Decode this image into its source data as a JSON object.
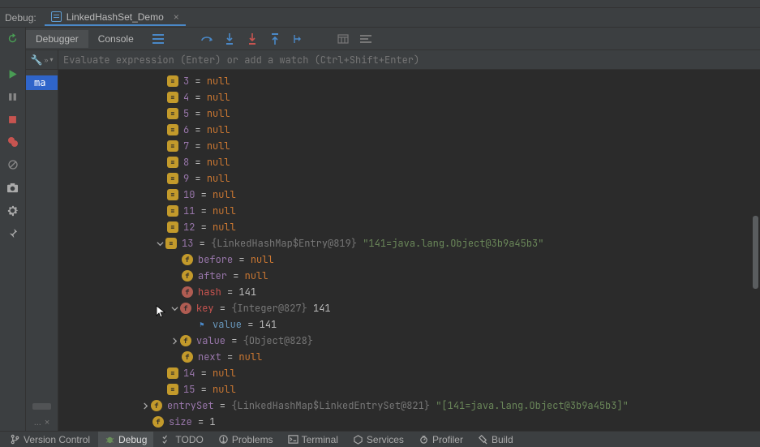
{
  "debug_label": "Debug:",
  "run_config": "LinkedHashSet_Demo",
  "tabs": {
    "debugger": "Debugger",
    "console": "Console"
  },
  "eval_placeholder": "Evaluate expression (Enter) or add a watch (Ctrl+Shift+Enter)",
  "frame_selected": "ma",
  "frames_footer": "...",
  "null_rows": [
    {
      "idx": "3",
      "val": "null"
    },
    {
      "idx": "4",
      "val": "null"
    },
    {
      "idx": "5",
      "val": "null"
    },
    {
      "idx": "6",
      "val": "null"
    },
    {
      "idx": "7",
      "val": "null"
    },
    {
      "idx": "8",
      "val": "null"
    },
    {
      "idx": "9",
      "val": "null"
    },
    {
      "idx": "10",
      "val": "null"
    },
    {
      "idx": "11",
      "val": "null"
    },
    {
      "idx": "12",
      "val": "null"
    }
  ],
  "entry13": {
    "idx": "13",
    "type": "{LinkedHashMap$Entry@819}",
    "text": "\"141=java.lang.Object@3b9a45b3\"",
    "before": {
      "name": "before",
      "val": "null"
    },
    "after": {
      "name": "after",
      "val": "null"
    },
    "hash": {
      "name": "hash",
      "val": "141"
    },
    "key": {
      "name": "key",
      "type": "{Integer@827}",
      "val": "141"
    },
    "key_value": {
      "name": "value",
      "val": "141"
    },
    "value": {
      "name": "value",
      "type": "{Object@828}"
    },
    "next": {
      "name": "next",
      "val": "null"
    }
  },
  "row14": {
    "idx": "14",
    "val": "null"
  },
  "row15": {
    "idx": "15",
    "val": "null"
  },
  "entrySet": {
    "name": "entrySet",
    "type": "{LinkedHashMap$LinkedEntrySet@821}",
    "text": "\"[141=java.lang.Object@3b9a45b3]\""
  },
  "size": {
    "name": "size",
    "val": "1"
  },
  "status_bar": {
    "vcs": "Version Control",
    "debug": "Debug",
    "todo": "TODO",
    "problems": "Problems",
    "terminal": "Terminal",
    "services": "Services",
    "profiler": "Profiler",
    "build": "Build"
  }
}
